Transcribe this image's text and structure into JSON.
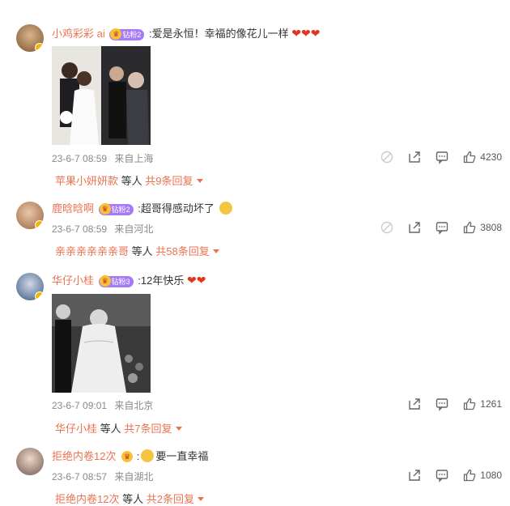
{
  "comments": [
    {
      "username": "小鸡彩彩 ai",
      "badge": "钻粉2",
      "text": ":爱是永恒！幸福的像花儿一样",
      "hearts": "❤❤❤",
      "time": "23-6-7 08:59",
      "location": "来自上海",
      "likes": "4230",
      "reply_names": "苹果小妍妍款",
      "reply_mid": "等人",
      "reply_count": "共9条回复"
    },
    {
      "username": "鹿晗晗啊",
      "badge": "钻粉2",
      "text": ":超哥得感动坏了",
      "hearts": "",
      "time": "23-6-7 08:59",
      "location": "来自河北",
      "likes": "3808",
      "reply_names": "亲亲亲亲亲亲哥",
      "reply_mid": "等人",
      "reply_count": "共58条回复"
    },
    {
      "username": "华仔小桂",
      "badge": "钻粉3",
      "text": ":12年快乐",
      "hearts": "❤❤",
      "time": "23-6-7 09:01",
      "location": "来自北京",
      "likes": "1261",
      "reply_names": "华仔小桂",
      "reply_mid": "等人",
      "reply_count": "共7条回复"
    },
    {
      "username": "拒绝内卷12次",
      "badge": "",
      "text": "要一直幸福",
      "hearts": "",
      "time": "23-6-7 08:57",
      "location": "来自湖北",
      "likes": "1080",
      "reply_names": "拒绝内卷12次",
      "reply_mid": "等人",
      "reply_count": "共2条回复"
    }
  ],
  "icons": {
    "share": "share-icon",
    "comment": "comment-icon",
    "like": "thumbs-up-icon",
    "ban": "block-icon",
    "verified": "verified-badge-icon"
  },
  "colors": {
    "accent": "#eb7350",
    "badge": "#a67bf7",
    "heart": "#e2351f"
  }
}
